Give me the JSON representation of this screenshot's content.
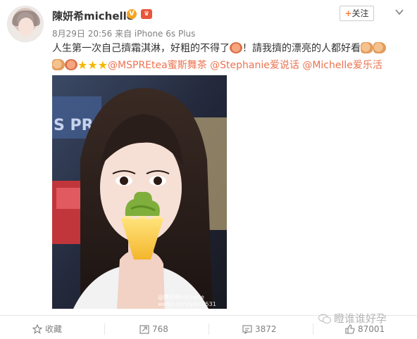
{
  "post": {
    "username": "陳妍希michelle",
    "meta": "8月29日 20:56 来自 iPhone 6s Plus",
    "follow_label": "关注",
    "follow_plus": "+",
    "text_part1": "人生第一次自己擠霜淇淋，好粗的不得了",
    "text_part2": "！請我擠的漂亮的人都好看",
    "mentions": [
      "@MSPREtea蜜斯舞茶",
      "@Stephanie爱说话",
      "@Michelle爱乐活"
    ],
    "photo_watermark_line1": "@陳妍希michelle",
    "photo_watermark_line2": "weibo.com/yanxi531"
  },
  "actions": {
    "favorite": "收藏",
    "repost_count": "768",
    "comment_count": "3872",
    "like_count": "87001"
  },
  "watermark": "瞪谁谁好孕",
  "colors": {
    "mention": "#eb7350",
    "accent": "#fa7d3c",
    "muted": "#808080"
  }
}
